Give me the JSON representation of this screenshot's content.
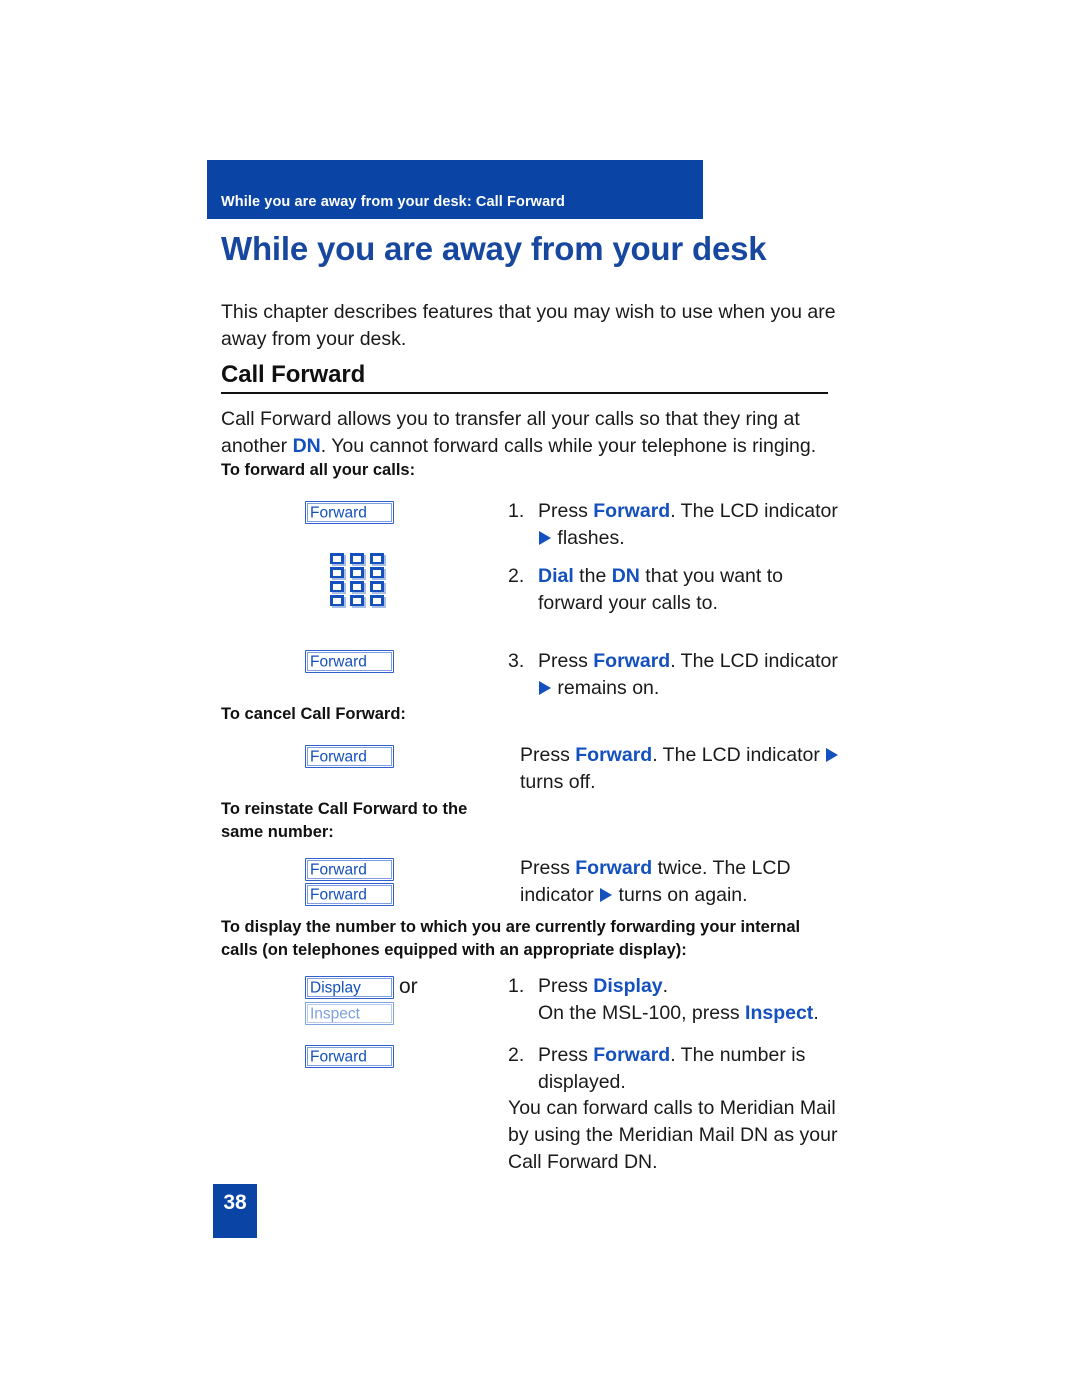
{
  "colors": {
    "banner_blue": "#0a45a5",
    "heading_blue": "#17479e",
    "key_blue": "#1450be",
    "key_blue_dim": "#7da0de",
    "body_text": "#1a1a1a"
  },
  "running_header": "While you are away from your desk: Call Forward",
  "chapter_title": "While you are away from your desk",
  "intro": "This chapter describes features that you may wish to use when you are away from your desk.",
  "section": {
    "heading": "Call Forward",
    "lead_part1": "Call Forward allows you to transfer all your calls so that they ring at another ",
    "lead_dn": "DN",
    "lead_part2": ". You cannot forward calls while your telephone is ringing."
  },
  "procedures": [
    {
      "caption": "To forward all your calls:",
      "steps": [
        {
          "number": "1.",
          "key": "Forward",
          "text_before": "Press ",
          "text_key": "Forward",
          "text_after": ". The LCD indicator ",
          "text_tail": " flashes."
        },
        {
          "number": "2.",
          "key": "keypad-icon",
          "text_key": "Dial",
          "text_mid": " the ",
          "text_key2": "DN",
          "text_after": " that you want to forward your calls to."
        },
        {
          "number": "3.",
          "key": "Forward",
          "text_before": "Press ",
          "text_key": "Forward",
          "text_after": ". The LCD indicator ",
          "text_tail": " remains on."
        }
      ]
    },
    {
      "caption": "To cancel Call Forward:",
      "steps": [
        {
          "number": "",
          "key": "Forward",
          "text_before": "Press ",
          "text_key": "Forward",
          "text_after": ". The LCD indicator ",
          "text_tail": " turns off."
        }
      ]
    },
    {
      "caption": "To reinstate Call Forward to the same number:",
      "steps": [
        {
          "number": "",
          "key": "Forward",
          "key2": "Forward",
          "text_before": "Press ",
          "text_key": "Forward",
          "text_after": " twice. The LCD indicator ",
          "text_tail": " turns on again."
        }
      ]
    },
    {
      "caption": "To display the number to which you are currently forwarding your internal calls (on telephones equipped with an appropriate display):",
      "steps": [
        {
          "number": "1.",
          "key": "Display",
          "or_label": "or",
          "key_dim": "Inspect",
          "text_before": "Press  ",
          "text_key": "Display",
          "text_after": ".",
          "line2_before": "On the MSL-100, press ",
          "line2_key": "Inspect",
          "line2_after": "."
        },
        {
          "number": "2.",
          "key": "Forward",
          "text_before": "Press  ",
          "text_key": "Forward",
          "text_after": ". The number is displayed."
        }
      ]
    }
  ],
  "closing_note": "You can forward calls to Meridian Mail by using the Meridian Mail DN as your Call Forward DN.",
  "page_number": "38"
}
